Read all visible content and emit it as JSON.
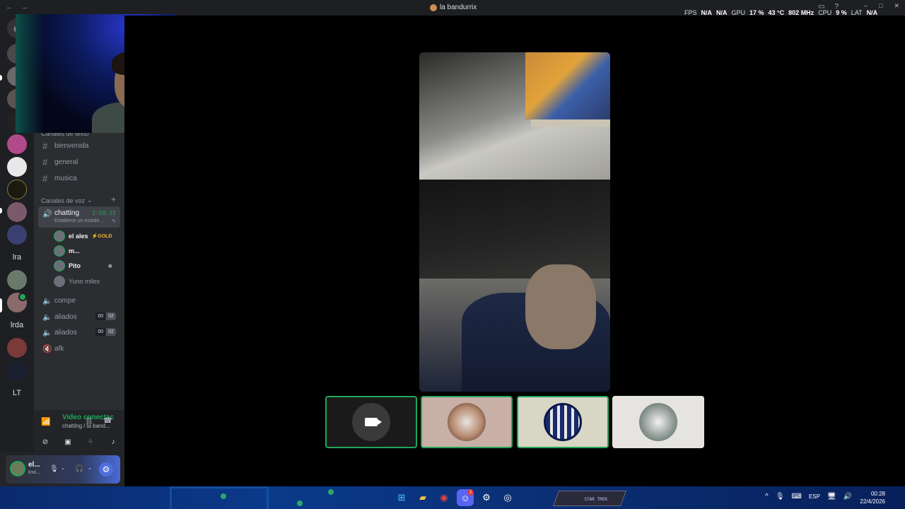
{
  "window": {
    "title": "la bandurrix",
    "back_label": "←",
    "forward_label": "→",
    "stats": {
      "fps_label": "FPS",
      "fps_value": "N/A",
      "fps_value2": "N/A",
      "gpu_label": "GPU",
      "gpu_usage": "17 %",
      "gpu_temp": "43 °C",
      "gpu_clock": "802 MHz",
      "cpu_label": "CPU",
      "cpu_usage": "9 %",
      "lat_label": "LAT",
      "lat_value": "N/A"
    }
  },
  "server_rail": {
    "servers": [
      "Discord",
      "server",
      "server",
      "server",
      "server",
      "server",
      "server",
      "server",
      "server",
      "server",
      "lra",
      "server",
      "server",
      "lrda",
      "server",
      "server",
      "LT"
    ]
  },
  "channels": {
    "text_category": "Canales de texto",
    "text_channels": [
      "bienvenida",
      "general",
      "musica"
    ],
    "voice_category": "Canales de voz",
    "active_voice": {
      "name": "chatting",
      "timer": "2:50:15",
      "status": "Establece un estado ..."
    },
    "members": [
      {
        "name": "el ales",
        "tag": "⚡GOLD"
      },
      {
        "name": "m..."
      },
      {
        "name": "Pito"
      },
      {
        "name": "Yuno miles"
      }
    ],
    "other_voice": [
      {
        "name": "compe"
      },
      {
        "name": "aliados",
        "count_a": "00",
        "count_b": "02"
      },
      {
        "name": "aliados",
        "count_a": "00",
        "count_b": "02"
      },
      {
        "name": "afk"
      }
    ]
  },
  "voice_panel": {
    "title": "Video conectac",
    "subtitle": "chatting / la band..."
  },
  "user_panel": {
    "name": "el...",
    "status": "Invi..."
  },
  "participants": [
    {
      "kind": "camera-off"
    },
    {
      "kind": "avatar-group"
    },
    {
      "kind": "avatar-crest"
    },
    {
      "kind": "avatar-couple"
    }
  ],
  "taskbar": {
    "discord_badge": "2",
    "lang": "ESP",
    "time": "00:28",
    "date": "22/4/2026",
    "wallpaper_text": "STAR TREK"
  },
  "colors": {
    "accent_green": "#23a55a",
    "blurple": "#5865f2",
    "sidebar": "#2b2d31",
    "rail": "#1e1f22"
  }
}
